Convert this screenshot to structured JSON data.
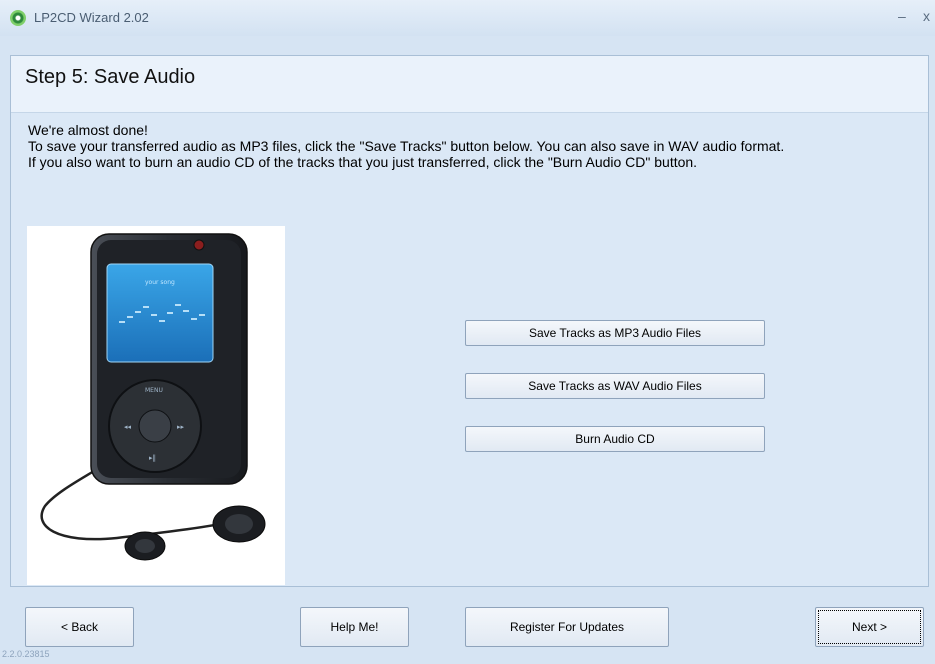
{
  "window": {
    "title": "LP2CD Wizard 2.02",
    "minimize_glyph": "–",
    "close_glyph": "x"
  },
  "step": {
    "title": "Step 5: Save Audio"
  },
  "description": {
    "line1": "We're almost done!",
    "line2": "To save your transferred audio as MP3 files, click the \"Save Tracks\" button below. You can also save in WAV audio format.",
    "line3": "If you also want to burn an audio CD of the tracks that you just transferred, click the \"Burn Audio CD\" button."
  },
  "illustration": {
    "screen_text": "your song",
    "wheel_label": "MENU"
  },
  "actions": {
    "save_mp3": "Save Tracks as MP3 Audio Files",
    "save_wav": "Save Tracks as WAV Audio Files",
    "burn_cd": "Burn Audio CD"
  },
  "footer": {
    "back": "< Back",
    "help": "Help Me!",
    "register": "Register For Updates",
    "next": "Next >",
    "version": "2.2.0.23815"
  },
  "colors": {
    "background": "#d6e4f3",
    "header": "#eaf2fb",
    "button_border": "#8fa3bb"
  }
}
